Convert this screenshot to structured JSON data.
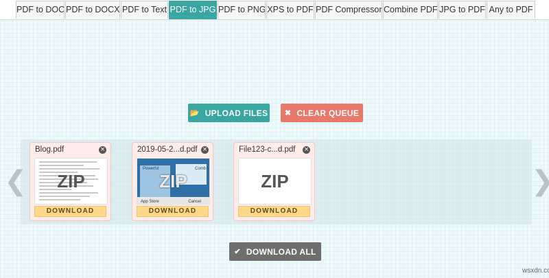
{
  "tabs": [
    {
      "label": "PDF to DOC",
      "active": false
    },
    {
      "label": "PDF to DOCX",
      "active": false
    },
    {
      "label": "PDF to Text",
      "active": false
    },
    {
      "label": "PDF to JPG",
      "active": true
    },
    {
      "label": "PDF to PNG",
      "active": false
    },
    {
      "label": "XPS to PDF",
      "active": false
    },
    {
      "label": "PDF Compressor",
      "active": false
    },
    {
      "label": "Combine PDF",
      "active": false
    },
    {
      "label": "JPG to PDF",
      "active": false
    },
    {
      "label": "Any to PDF",
      "active": false
    }
  ],
  "actions": {
    "upload_label": "UPLOAD FILES",
    "upload_icon": "folder-open-icon",
    "clear_label": "CLEAR QUEUE",
    "clear_icon": "x-icon",
    "download_all_label": "DOWNLOAD ALL",
    "download_all_icon": "check-icon"
  },
  "files": [
    {
      "name": "Blog.pdf",
      "badge": "ZIP",
      "download_label": "DOWNLOAD",
      "preview": "document"
    },
    {
      "name": "2019-05-2...d.pdf",
      "badge": "ZIP",
      "download_label": "DOWNLOAD",
      "preview": "screenshot",
      "preview_texts": [
        "Powerful",
        "Comb",
        "App Store",
        "Cancel"
      ]
    },
    {
      "name": "File123-c...d.pdf",
      "badge": "ZIP",
      "download_label": "DOWNLOAD",
      "preview": "blank"
    }
  ],
  "watermark": "wsxdn.com",
  "colors": {
    "accent": "#3aa6a1",
    "danger": "#e8786a",
    "neutral": "#6e6e6e",
    "card_bg": "#fdecea",
    "download": "#fdd88b"
  }
}
